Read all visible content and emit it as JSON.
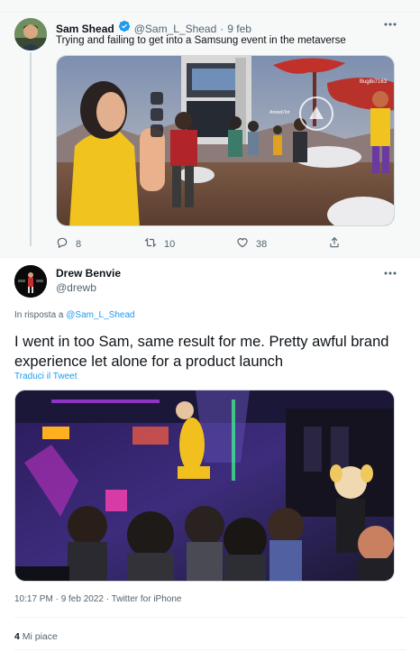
{
  "tweet1": {
    "author_name": "Sam Shead",
    "handle": "@Sam_L_Shead",
    "separator": "·",
    "date": "9 feb",
    "text": "Trying and failing to get into a Samsung event in the metaverse",
    "replies": "8",
    "retweets": "10",
    "likes": "38",
    "media_labels": [
      "Bugibi7163",
      "AmoebTot"
    ]
  },
  "tweet2": {
    "author_name": "Drew Benvie",
    "handle": "@drewb",
    "reply_prefix": "In risposta a",
    "reply_to": "@Sam_L_Shead",
    "text": "I went in too Sam, same result for me. Pretty awful brand experience let alone for a product launch",
    "translate": "Traduci il Tweet",
    "timestamp": "10:17 PM · 9 feb 2022 · Twitter for iPhone",
    "like_count": "4",
    "like_label": "Mi piace"
  },
  "colors": {
    "accent": "#1d9bf0",
    "muted": "#536471",
    "text": "#0f1419"
  },
  "icons": [
    "verified-badge-icon",
    "more-icon",
    "reply-icon",
    "retweet-icon",
    "like-icon",
    "share-icon"
  ]
}
